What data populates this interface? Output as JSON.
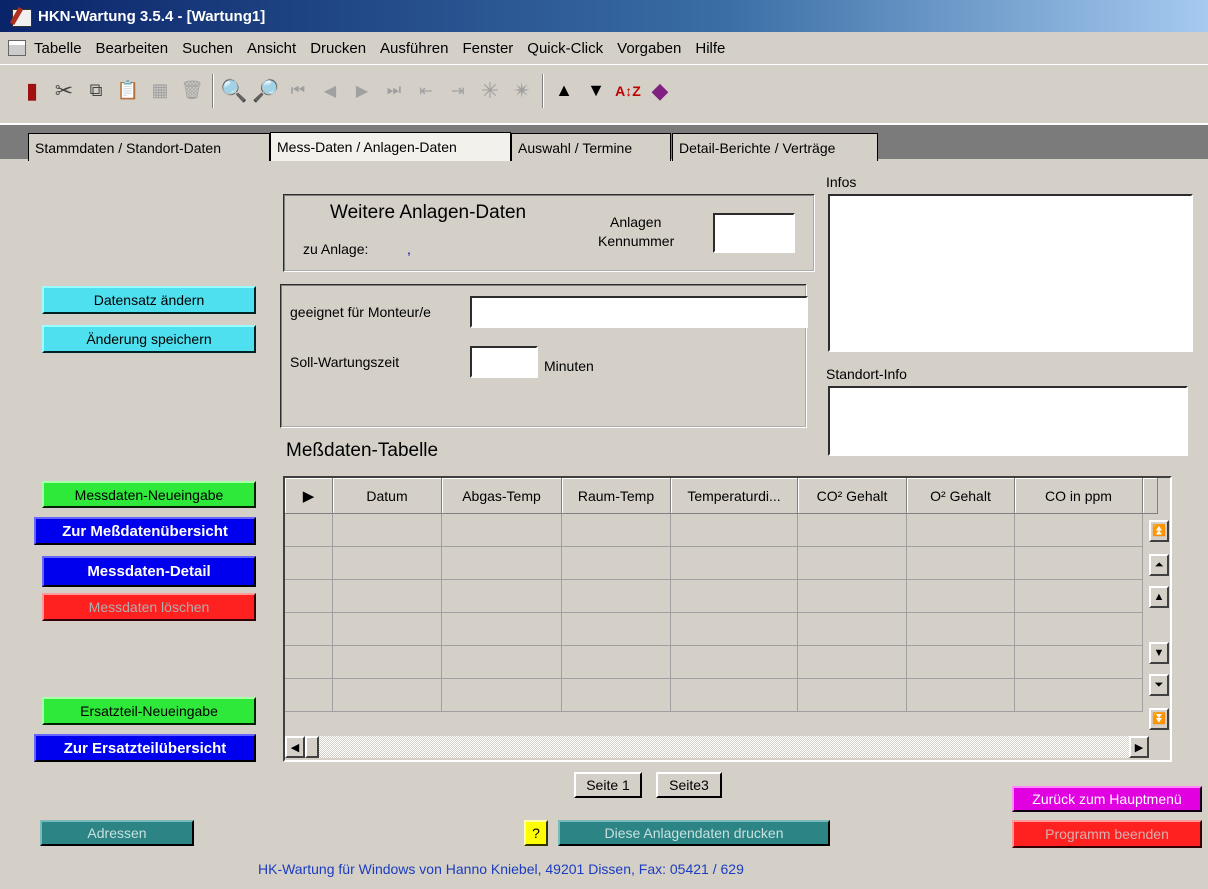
{
  "window": {
    "title": "HKN-Wartung 3.5.4 - [Wartung1]"
  },
  "menu": [
    "Tabelle",
    "Bearbeiten",
    "Suchen",
    "Ansicht",
    "Drucken",
    "Ausführen",
    "Fenster",
    "Quick-Click",
    "Vorgaben",
    "Hilfe"
  ],
  "tabs": [
    "Stammdaten / Standort-Daten",
    "Mess-Daten / Anlagen-Daten",
    "Auswahl /  Termine",
    "Detail-Berichte / Verträge"
  ],
  "active_tab": "Mess-Daten / Anlagen-Daten",
  "header": {
    "title": "Weitere Anlagen-Daten",
    "zu_anlage_label": "zu Anlage:",
    "zu_anlage_value": ",",
    "kennummer_label_1": "Anlagen",
    "kennummer_label_2": "Kennummer",
    "kennummer_value": ""
  },
  "form": {
    "monteur_label": "geeignet für Monteur/e",
    "monteur_value": "",
    "soll_label": "Soll-Wartungszeit",
    "soll_value": "",
    "soll_unit": "Minuten"
  },
  "infos": {
    "label": "Infos",
    "value": ""
  },
  "standort_info": {
    "label": "Standort-Info",
    "value": ""
  },
  "buttons": {
    "datensatz_aendern": "Datensatz ändern",
    "aenderung_speichern": "Änderung speichern",
    "messdaten_neueingabe": "Messdaten-Neueingabe",
    "zur_messdatenuebersicht": "Zur Meßdatenübersicht",
    "messdaten_detail": "Messdaten-Detail",
    "messdaten_loeschen": "Messdaten löschen",
    "ersatzteil_neueingabe": "Ersatzteil-Neueingabe",
    "zur_ersatzteiluebersicht": "Zur Ersatzteilübersicht",
    "adressen": "Adressen",
    "help": "?",
    "drucken": "Diese Anlagendaten drucken",
    "seite1": "Seite 1",
    "seite3": "Seite3",
    "zurueck": "Zurück zum Hauptmenü",
    "beenden": "Programm beenden"
  },
  "table": {
    "title": "Meßdaten-Tabelle",
    "row_indicator": "▶",
    "columns": [
      "Datum",
      "Abgas-Temp",
      "Raum-Temp",
      "Temperaturdi...",
      "CO² Gehalt",
      "O² Gehalt",
      "CO in ppm"
    ],
    "rows": 6
  },
  "footer": {
    "text": "HK-Wartung für Windows von Hanno Kniebel, 49201 Dissen, Fax: 05421 / 629"
  }
}
